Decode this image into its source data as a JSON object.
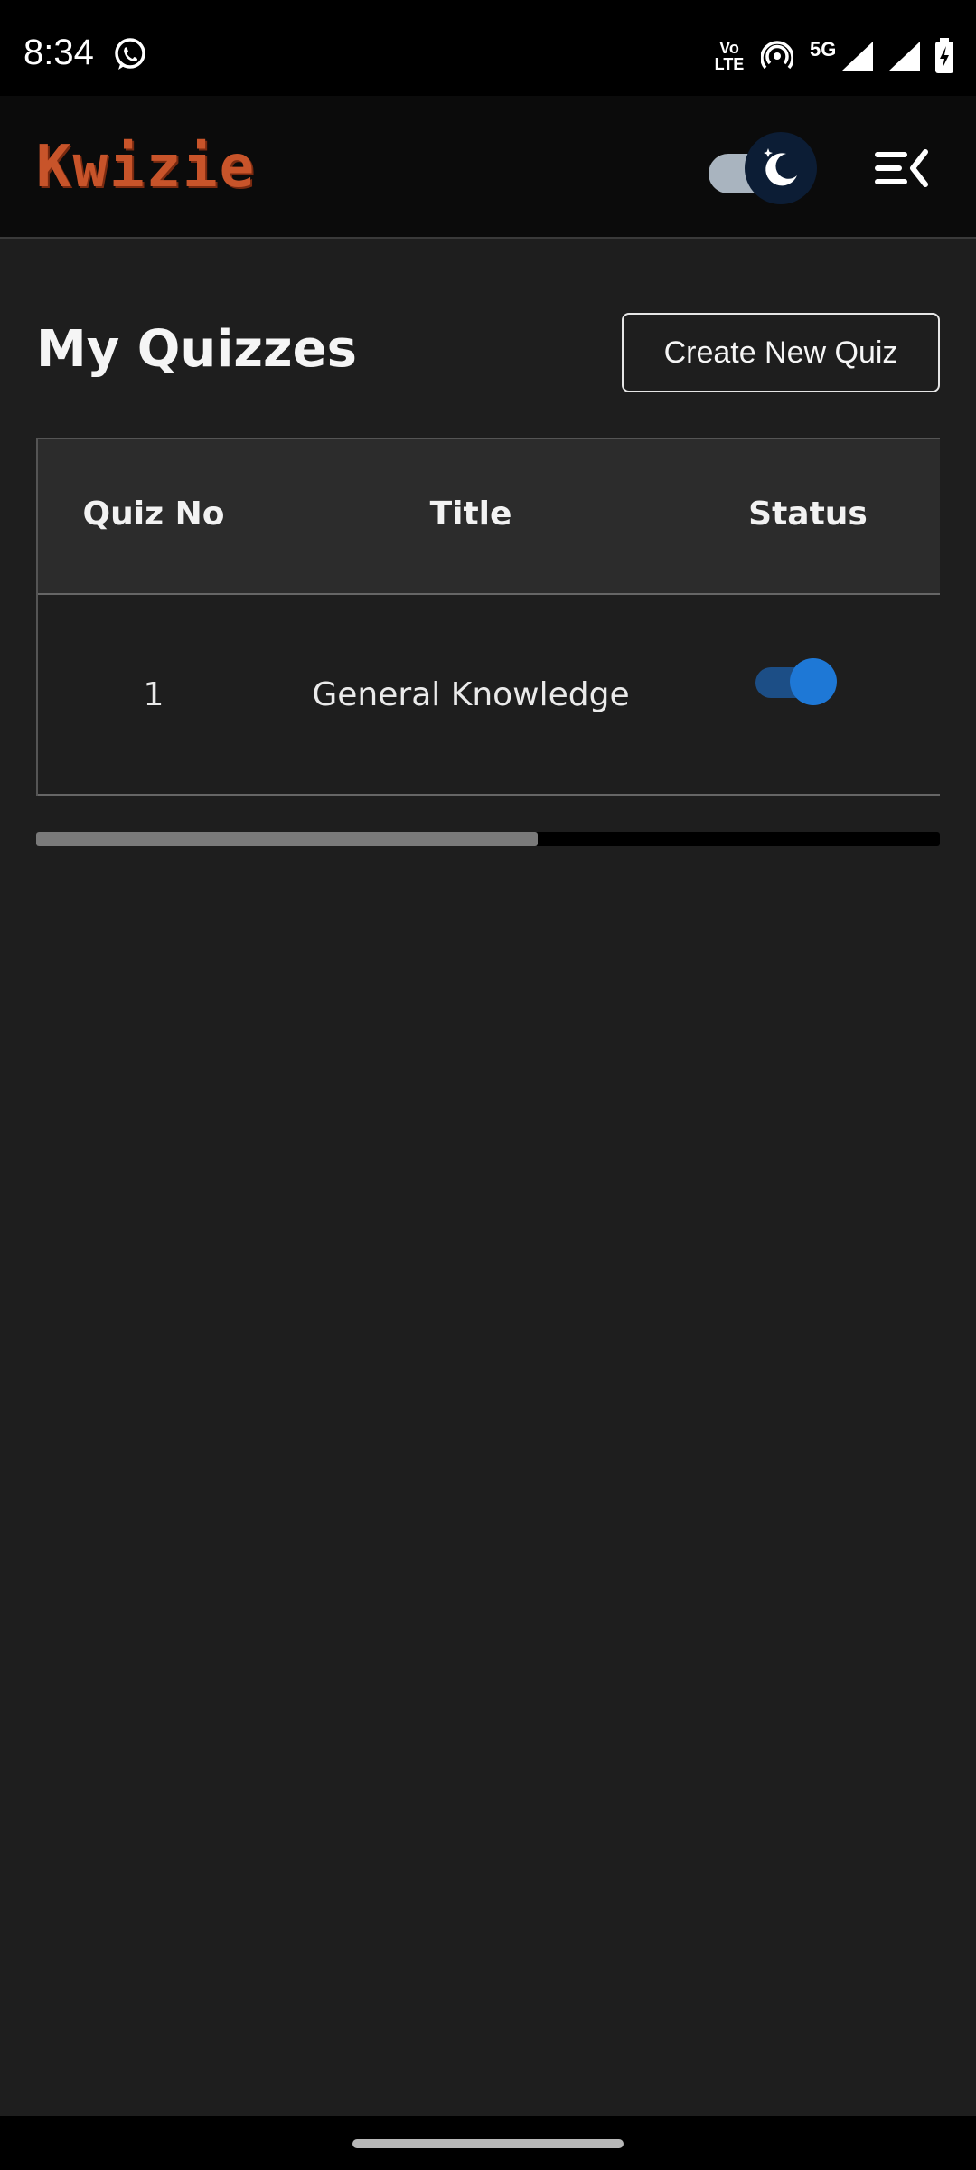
{
  "status_bar": {
    "time": "8:34",
    "icons": [
      "whatsapp-icon",
      "volte-icon",
      "hotspot-icon",
      "5g-signal-icon",
      "signal-icon",
      "signal-icon",
      "battery-charging-icon"
    ],
    "volte_label": "Vo LTE",
    "network_label": "5G"
  },
  "header": {
    "logo_text": "Kwizie",
    "theme_toggle": {
      "mode": "dark",
      "icon": "moon-icon",
      "on": true
    },
    "menu_icon": "menu-collapse-icon"
  },
  "main": {
    "title": "My Quizzes",
    "create_button_label": "Create New Quiz",
    "table": {
      "columns": [
        "Quiz No",
        "Title",
        "Status"
      ],
      "rows": [
        {
          "quiz_no": "1",
          "title": "General Knowledge",
          "status_enabled": true
        }
      ]
    },
    "scroll": {
      "thumb_fraction": 0.555
    }
  },
  "colors": {
    "background": "#1e1e1e",
    "header_bg": "#0b0b0b",
    "logo": "#c8542a",
    "accent": "#1e78d6"
  }
}
